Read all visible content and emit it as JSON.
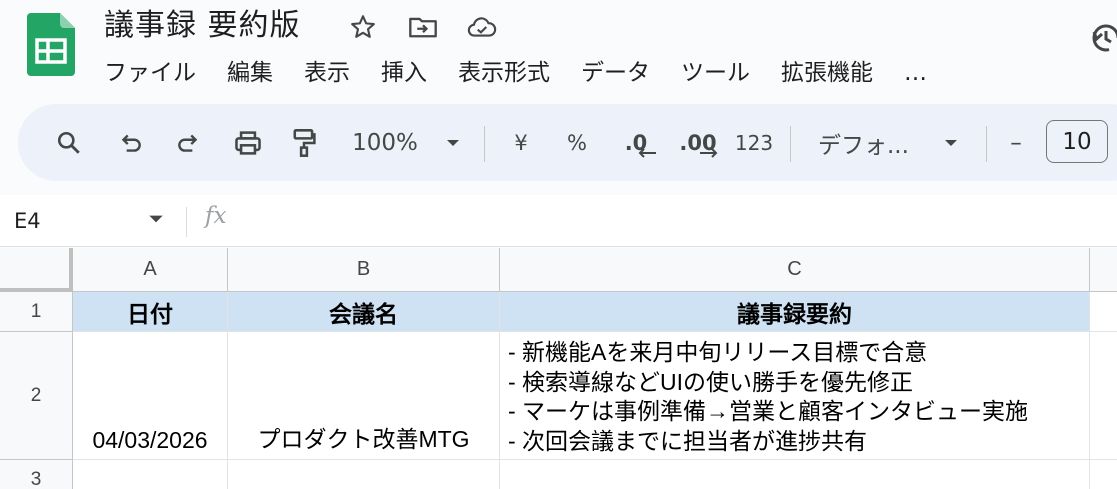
{
  "app": {
    "doc_title": "議事録 要約版",
    "icons": {
      "logo": "google-sheets-logo",
      "star": "star-icon",
      "move": "move-to-folder-icon",
      "cloud": "cloud-saved-icon",
      "history": "version-history-icon"
    }
  },
  "menu": [
    "ファイル",
    "編集",
    "表示",
    "挿入",
    "表示形式",
    "データ",
    "ツール",
    "拡張機能",
    "…"
  ],
  "toolbar": {
    "zoom": "100%",
    "currency": "¥",
    "percent": "%",
    "decrease_decimal": ".0",
    "increase_decimal": ".00",
    "number_format": "123",
    "font": "デフォ...",
    "font_size": "10",
    "minus": "–"
  },
  "formula_bar": {
    "name_box": "E4",
    "fx": "fx",
    "content": ""
  },
  "sheet": {
    "columns": [
      "A",
      "B",
      "C"
    ],
    "rows": [
      "1",
      "2",
      "3"
    ],
    "header": [
      "日付",
      "会議名",
      "議事録要約"
    ],
    "row2": {
      "date": "04/03/2026",
      "meeting": "プロダクト改善MTG",
      "summary": [
        "- 新機能Aを来月中旬リリース目標で合意",
        "- 検索導線などUIの使い勝手を優先修正",
        "- マーケは事例準備→営業と顧客インタビュー実施",
        "- 次回会議までに担当者が進捗共有"
      ]
    },
    "header_fill": "#cfe2f3"
  },
  "colors": {
    "sheets_green": "#23a566",
    "toolbar_bg": "#edf2fa",
    "page_bg": "#f9fbfd"
  }
}
